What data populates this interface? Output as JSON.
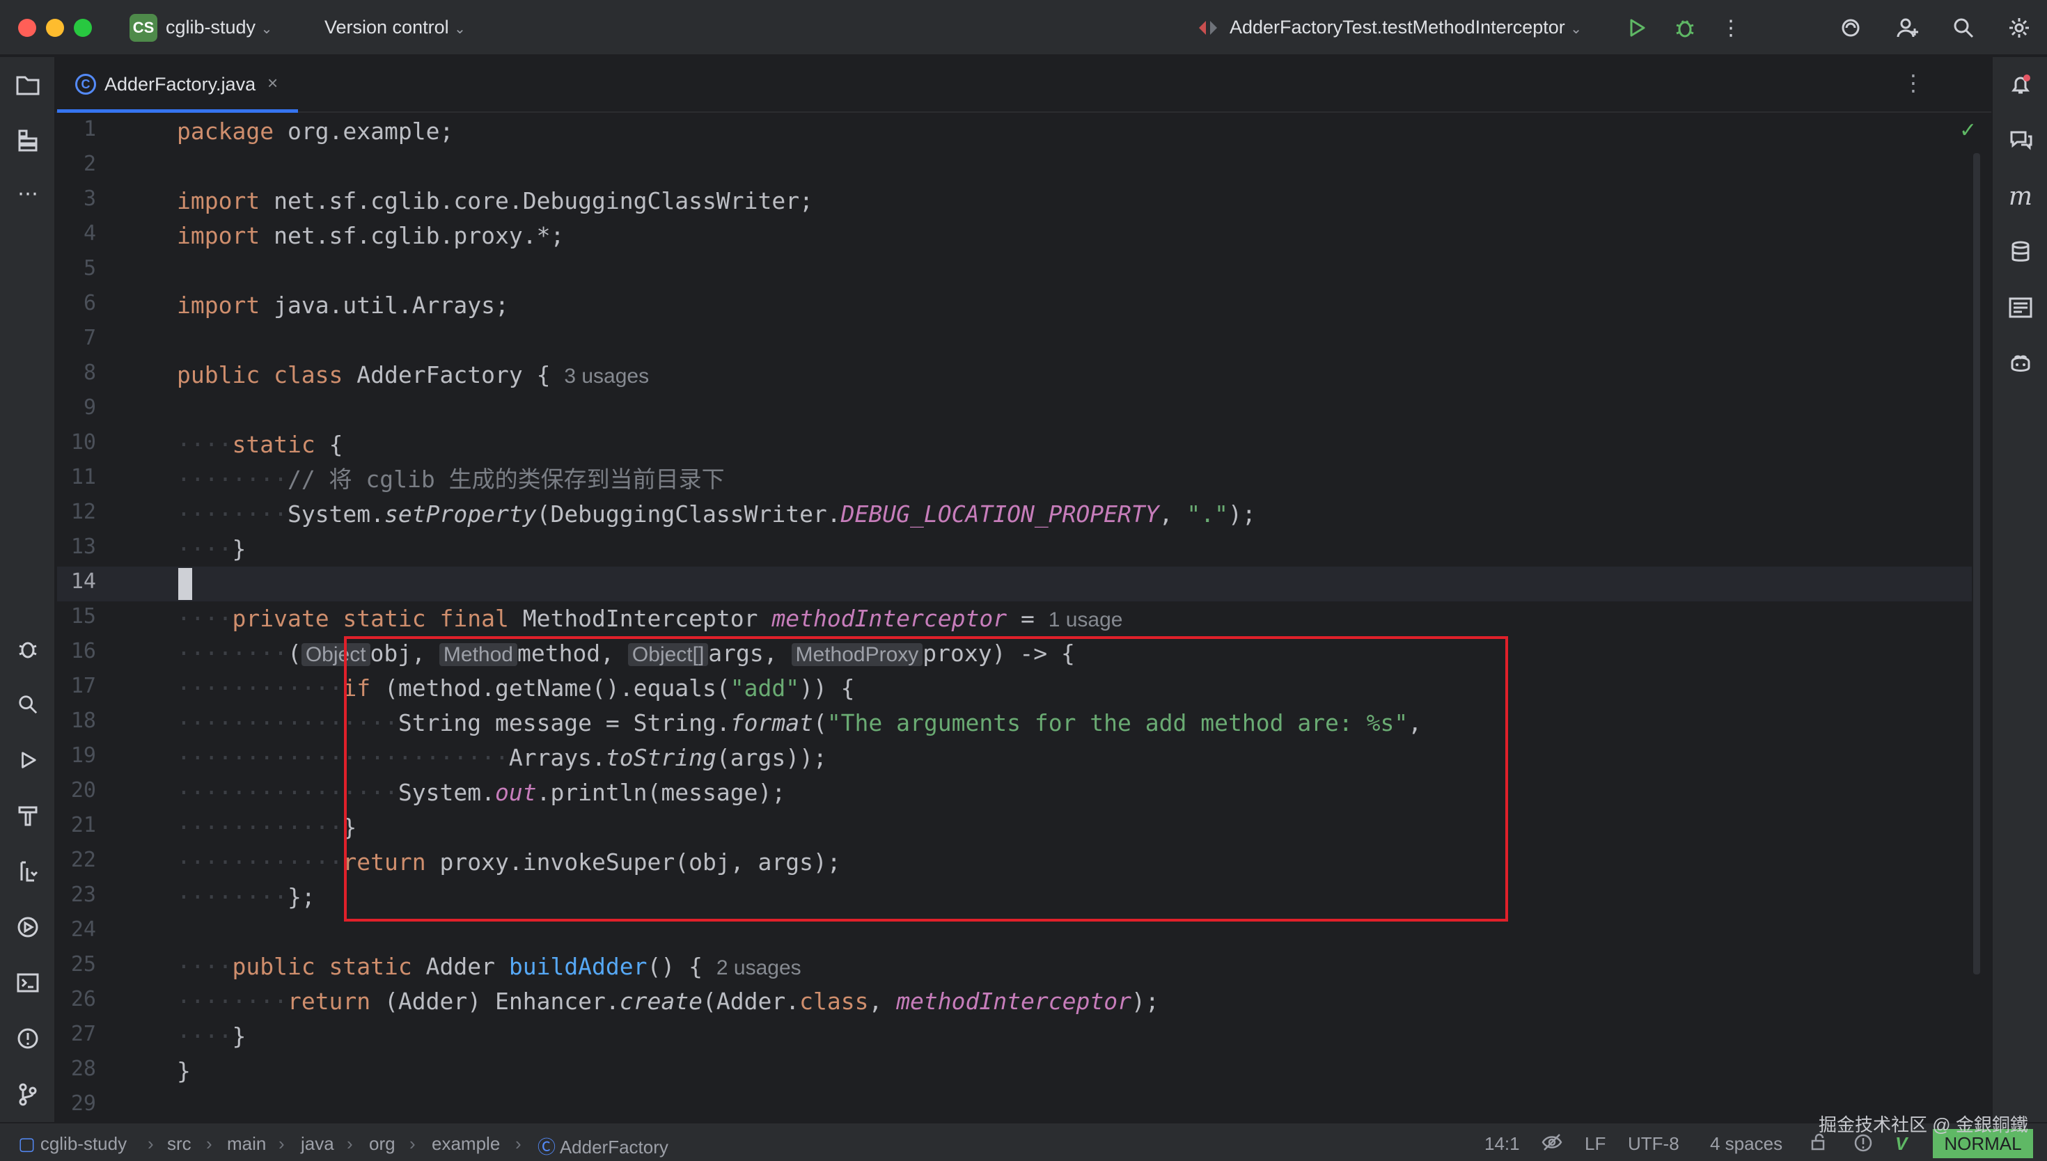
{
  "titlebar": {
    "project_badge": "CS",
    "project_name": "cglib-study",
    "version_control": "Version control",
    "run_config": "AdderFactoryTest.testMethodInterceptor",
    "icons": [
      "run-icon",
      "debug-icon",
      "more-icon",
      "ai-assistant-icon",
      "add-user-icon",
      "search-icon",
      "settings-icon"
    ]
  },
  "tab": {
    "label": "AdderFactory.java",
    "close": "×",
    "more": "⋮"
  },
  "left_sidebar_icons": [
    "project-folder-icon",
    "structure-icon",
    "more-tools-icon",
    "debug-tool-icon",
    "find-icon",
    "run-tool-icon",
    "build-icon",
    "services-icon",
    "run-dashboard-icon",
    "terminal-icon",
    "problems-icon",
    "git-icon"
  ],
  "right_sidebar_icons": [
    "notifications-icon",
    "ai-chat-icon",
    "maven-icon",
    "database-icon",
    "reader-mode-icon",
    "copilot-icon"
  ],
  "editor": {
    "current_line": 14,
    "line_numbers": [
      "1",
      "2",
      "3",
      "4",
      "5",
      "6",
      "7",
      "8",
      "9",
      "10",
      "11",
      "12",
      "13",
      "14",
      "15",
      "16",
      "17",
      "18",
      "19",
      "20",
      "21",
      "22",
      "23",
      "24",
      "25",
      "26",
      "27",
      "28",
      "29"
    ],
    "code": {
      "l1_kw": "package",
      "l1_rest": " org.example;",
      "l3_kw": "import",
      "l3_rest": " net.sf.cglib.core.DebuggingClassWriter;",
      "l4_kw": "import",
      "l4_rest": " net.sf.cglib.proxy.*;",
      "l6_kw": "import",
      "l6_rest": " java.util.Arrays;",
      "l8_kw": "public class",
      "l8_rest": " AdderFactory { ",
      "l8_hint": "3 usages",
      "l10_kw": "static",
      "l10_rest": " {",
      "l11_cm": "// 将 cglib 生成的类保存到当前目录下",
      "l12_a": "System.",
      "l12_b": "setProperty",
      "l12_c": "(DebuggingClassWriter.",
      "l12_d": "DEBUG_LOCATION_PROPERTY",
      "l12_e": ", ",
      "l12_f": "\".\"",
      "l12_g": ");",
      "l13": "}",
      "l15_kw": "private static final",
      "l15_type": " MethodInterceptor ",
      "l15_fld": "methodInterceptor",
      "l15_eq": " = ",
      "l15_hint": "1 usage",
      "l16_open": "(",
      "l16_h1": "Object",
      "l16_p1": "obj, ",
      "l16_h2": "Method",
      "l16_p2": "method, ",
      "l16_h3": "Object[]",
      "l16_p3": "args, ",
      "l16_h4": "MethodProxy",
      "l16_p4": "proxy) -> {",
      "l17_kw": "if",
      "l17_a": " (method.getName().equals(",
      "l17_str": "\"add\"",
      "l17_b": ")) {",
      "l18_a": "String message = String.",
      "l18_b": "format",
      "l18_c": "(",
      "l18_str": "\"The arguments for the add method are: %s\"",
      "l18_d": ",",
      "l19_a": "Arrays.",
      "l19_b": "toString",
      "l19_c": "(args));",
      "l20_a": "System.",
      "l20_b": "out",
      "l20_c": ".println(message);",
      "l21": "}",
      "l22_kw": "return",
      "l22_rest": " proxy.invokeSuper(obj, args);",
      "l23": "};",
      "l25_kw": "public static",
      "l25_a": " Adder ",
      "l25_fn": "buildAdder",
      "l25_b": "() { ",
      "l25_hint": "2 usages",
      "l26_kw": "return",
      "l26_a": " (Adder) Enhancer.",
      "l26_b": "create",
      "l26_c": "(Adder.",
      "l26_kw2": "class",
      "l26_d": ", ",
      "l26_fld": "methodInterceptor",
      "l26_e": ");",
      "l27": "}",
      "l28": "}"
    }
  },
  "statusbar": {
    "breadcrumbs": [
      "cglib-study",
      "src",
      "main",
      "java",
      "org",
      "example",
      "AdderFactory"
    ],
    "position": "14:1",
    "line_ending": "LF",
    "encoding": "UTF-8",
    "indent": "4 spaces",
    "vim_mode": "NORMAL",
    "watermark": "掘金技术社区 @ 金銀銅鐵"
  }
}
